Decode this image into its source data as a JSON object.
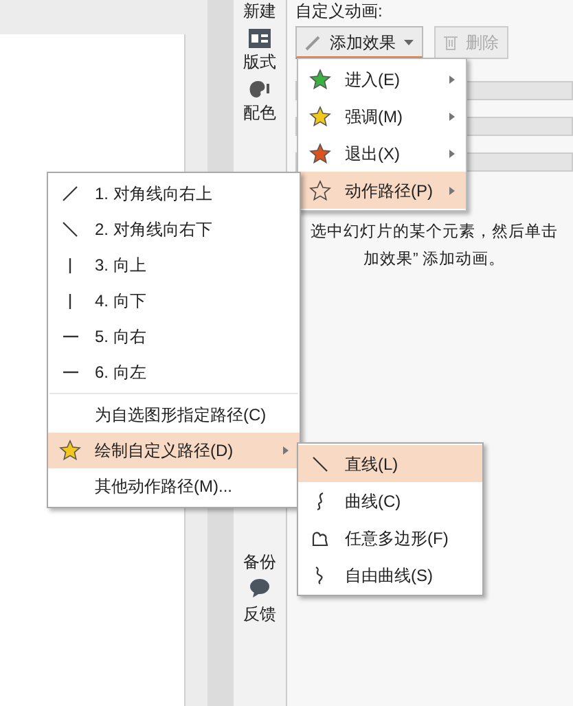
{
  "sidebar": {
    "items": [
      {
        "label": "新建"
      },
      {
        "label": "版式"
      },
      {
        "label": "配色"
      }
    ],
    "bottom_items": [
      {
        "label": "备份"
      },
      {
        "label": "反馈"
      }
    ]
  },
  "panel": {
    "title": "自定义动画:",
    "add_button": "添加效果",
    "delete_button": {
      "label": "删除",
      "disabled": true
    },
    "hint_lines": [
      "选中幻灯片的某个元素，然后单击",
      "加效果” 添加动画。"
    ]
  },
  "effect_menu": [
    {
      "label": "进入(E)",
      "selected": false
    },
    {
      "label": "强调(M)",
      "selected": false
    },
    {
      "label": "退出(X)",
      "selected": false
    },
    {
      "label": "动作路径(P)",
      "selected": true
    }
  ],
  "path_menu": [
    {
      "kind": "item",
      "label": "1. 对角线向右上",
      "selected": false
    },
    {
      "kind": "item",
      "label": "2. 对角线向右下",
      "selected": false
    },
    {
      "kind": "item",
      "label": "3. 向上",
      "selected": false
    },
    {
      "kind": "item",
      "label": "4. 向下",
      "selected": false
    },
    {
      "kind": "item",
      "label": "5. 向右",
      "selected": false
    },
    {
      "kind": "item",
      "label": "6. 向左",
      "selected": false
    },
    {
      "kind": "separator"
    },
    {
      "kind": "item",
      "label": "为自选图形指定路径(C)",
      "selected": false
    },
    {
      "kind": "submenu",
      "label": "绘制自定义路径(D)",
      "selected": true
    },
    {
      "kind": "item",
      "label": "其他动作路径(M)...",
      "selected": false
    }
  ],
  "draw_menu": [
    {
      "label": "直线(L)",
      "selected": true
    },
    {
      "label": "曲线(C)",
      "selected": false
    },
    {
      "label": "任意多边形(F)",
      "selected": false
    },
    {
      "label": "自由曲线(S)",
      "selected": false
    }
  ]
}
